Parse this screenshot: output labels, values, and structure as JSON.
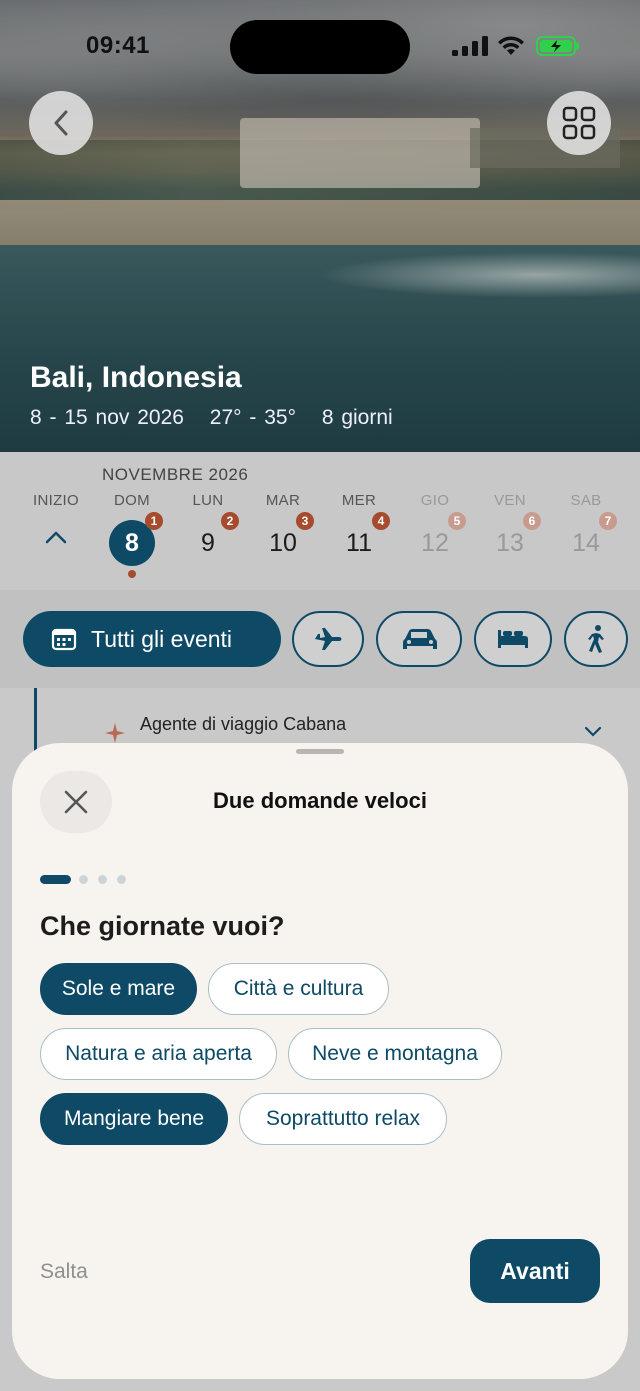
{
  "status_bar": {
    "time": "09:41"
  },
  "hero": {
    "title": "Bali, Indonesia",
    "dates": "8 - 15 nov 2026",
    "temperature": "27° - 35°",
    "duration": "8 giorni",
    "back_icon": "chevron-left-icon",
    "grid_icon": "grid-icon"
  },
  "calendar": {
    "month": "NOVEMBRE 2026",
    "start_label": "INIZIO",
    "days": [
      {
        "name": "DOM",
        "num": "8",
        "badge": "1"
      },
      {
        "name": "LUN",
        "num": "9",
        "badge": "2"
      },
      {
        "name": "MAR",
        "num": "10",
        "badge": "3"
      },
      {
        "name": "MER",
        "num": "11",
        "badge": "4"
      },
      {
        "name": "GIO",
        "num": "12",
        "badge": "5"
      },
      {
        "name": "VEN",
        "num": "13",
        "badge": "6"
      },
      {
        "name": "SAB",
        "num": "14",
        "badge": "7"
      }
    ],
    "selected_color": "#0e4a66",
    "badge_color": "#a74b2e"
  },
  "filters": {
    "all_label": "Tutti gli eventi",
    "icons": [
      "plane-icon",
      "car-icon",
      "bed-icon",
      "walking-icon"
    ]
  },
  "list": {
    "agent_title": "Agente di viaggio Cabana"
  },
  "sheet": {
    "title": "Due domande veloci",
    "question": "Che giornate vuoi?",
    "step": 1,
    "total_steps": 4,
    "options": [
      {
        "label": "Sole e mare",
        "selected": true
      },
      {
        "label": "Città e cultura",
        "selected": false
      },
      {
        "label": "Natura e aria aperta",
        "selected": false
      },
      {
        "label": "Neve e montagna",
        "selected": false
      },
      {
        "label": "Mangiare bene",
        "selected": true
      },
      {
        "label": "Soprattutto relax",
        "selected": false
      }
    ],
    "skip_label": "Salta",
    "next_label": "Avanti"
  }
}
